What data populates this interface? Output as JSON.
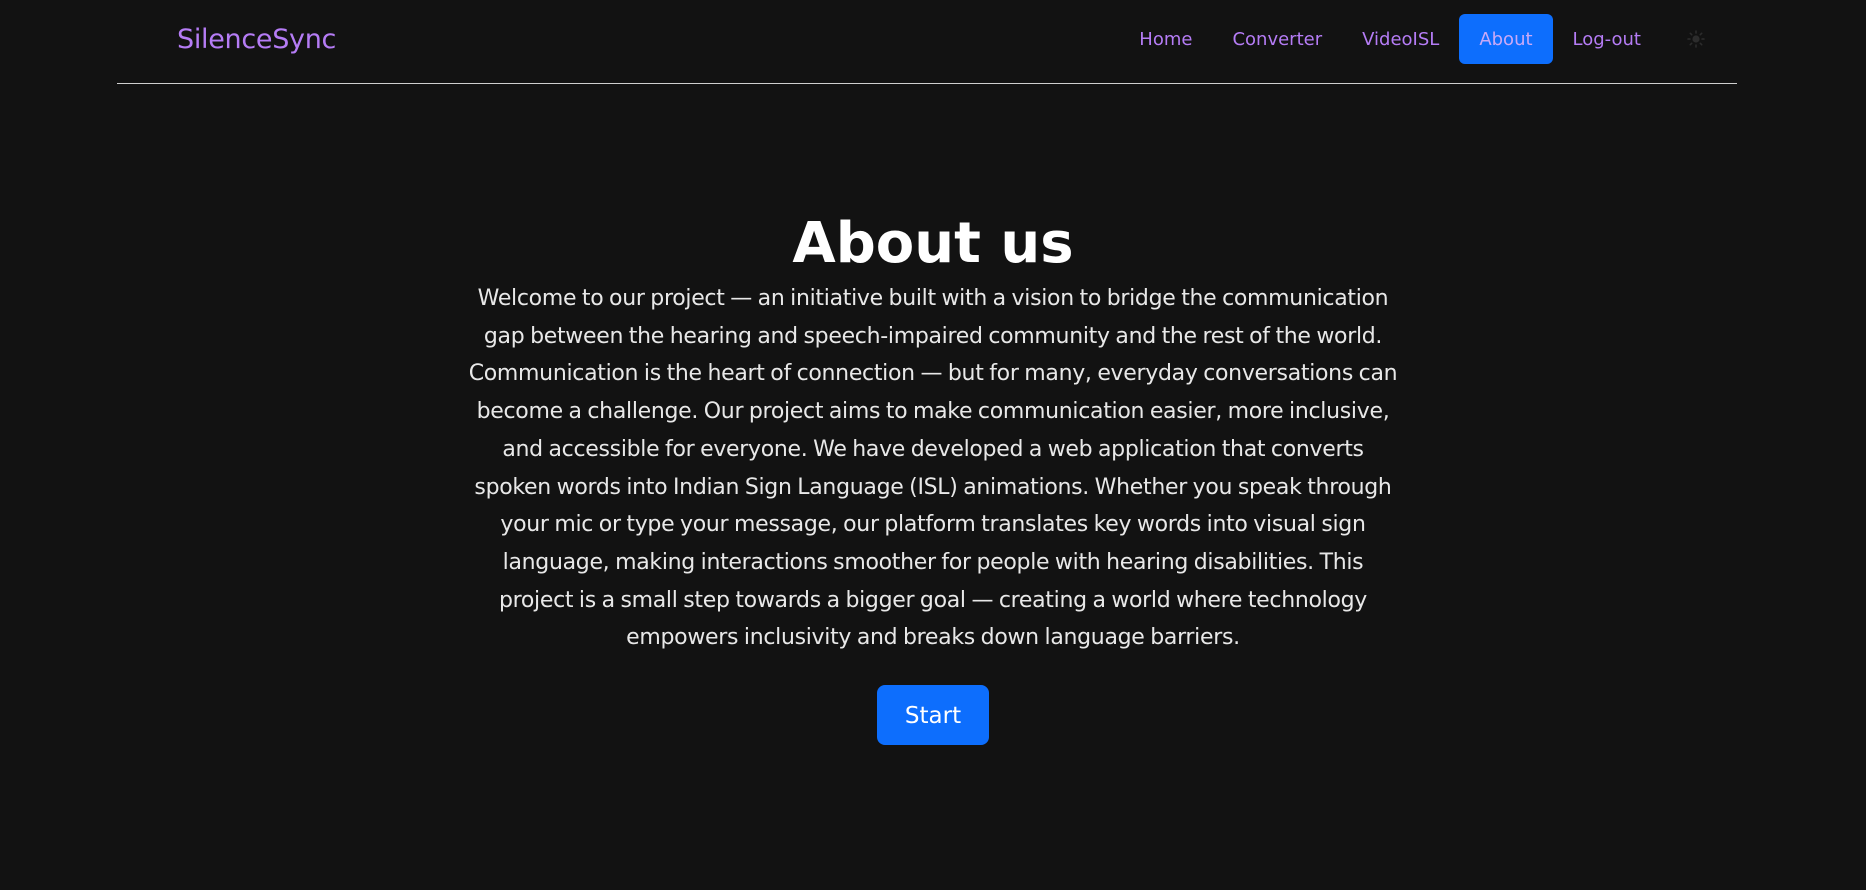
{
  "navbar": {
    "brand": "SilenceSync",
    "links": [
      {
        "label": "Home",
        "active": false
      },
      {
        "label": "Converter",
        "active": false
      },
      {
        "label": "VideoISL",
        "active": false
      },
      {
        "label": "About",
        "active": true
      },
      {
        "label": "Log-out",
        "active": false
      }
    ],
    "theme_toggle_icon": "sun-icon"
  },
  "main": {
    "title": "About us",
    "description": "Welcome to our project — an initiative built with a vision to bridge the communication gap between the hearing and speech-impaired community and the rest of the world. Communication is the heart of connection — but for many, everyday conversations can become a challenge. Our project aims to make communication easier, more inclusive, and accessible for everyone. We have developed a web application that converts spoken words into Indian Sign Language (ISL) animations. Whether you speak through your mic or type your message, our platform translates key words into visual sign language, making interactions smoother for people with hearing disabilities. This project is a small step towards a bigger goal — creating a world where technology empowers inclusivity and breaks down language barriers.",
    "start_label": "Start"
  },
  "colors": {
    "background": "#121212",
    "brand": "#b57cf5",
    "accent": "#0d6efd",
    "text": "#ffffff"
  }
}
